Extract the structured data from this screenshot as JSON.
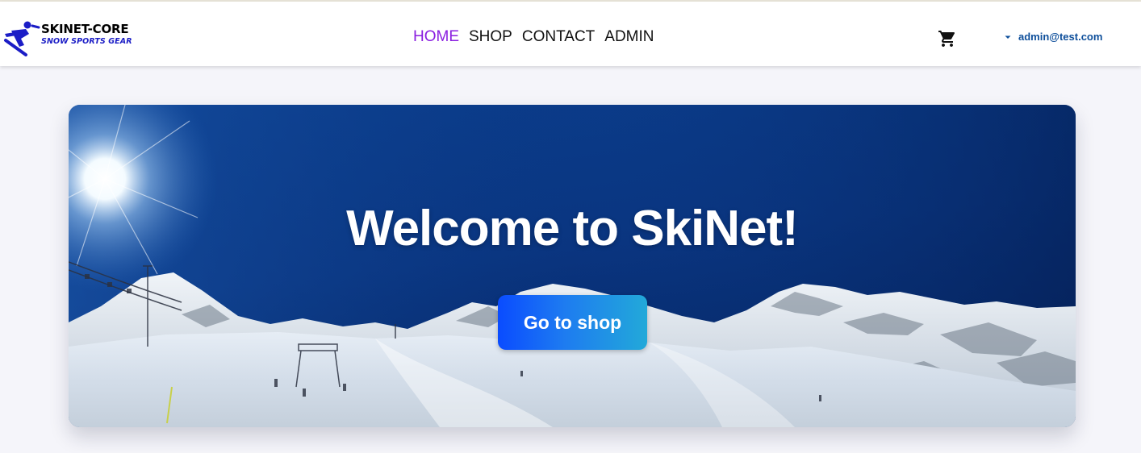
{
  "brand": {
    "name": "SKINET-CORE",
    "tagline": "SNOW SPORTS GEAR"
  },
  "nav": {
    "items": [
      {
        "label": "HOME",
        "active": true
      },
      {
        "label": "SHOP",
        "active": false
      },
      {
        "label": "CONTACT",
        "active": false
      },
      {
        "label": "ADMIN",
        "active": false
      }
    ]
  },
  "header": {
    "cart_icon": "shopping-cart-icon",
    "user_email": "admin@test.com",
    "user_caret_icon": "caret-down-icon"
  },
  "hero": {
    "title": "Welcome to SkiNet!",
    "button_label": "Go to shop",
    "background": "snowy-mountain-ski-slope-panorama"
  },
  "colors": {
    "nav_active": "#8a1ee0",
    "email": "#0e4f9b",
    "page_bg": "#f5f5fa",
    "button_gradient_start": "#0a4cff",
    "button_gradient_end": "#22a9d9"
  }
}
